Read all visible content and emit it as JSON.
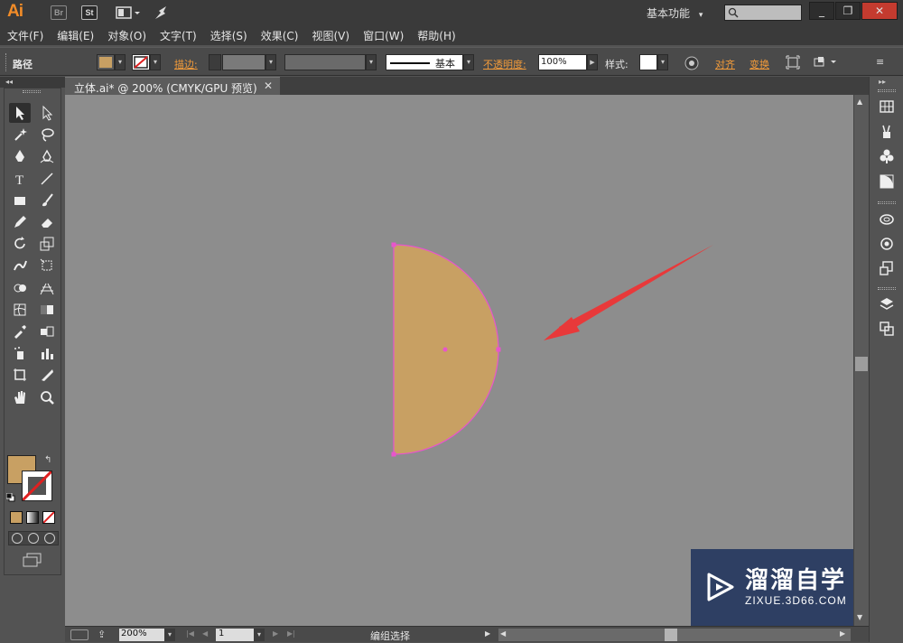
{
  "app": {
    "logo": "Ai",
    "bridge_label": "Br",
    "stock_label": "St",
    "workspace_label": "基本功能",
    "workspace_chevron": "▾",
    "window_buttons": [
      "_",
      "❐",
      "✕"
    ]
  },
  "menu": [
    "文件(F)",
    "编辑(E)",
    "对象(O)",
    "文字(T)",
    "选择(S)",
    "效果(C)",
    "视图(V)",
    "窗口(W)",
    "帮助(H)"
  ],
  "control_bar": {
    "selection_type": "路径",
    "fill_color": "#c8a063",
    "stroke_label": "描边:",
    "brush_label": "基本",
    "opacity_label": "不透明度:",
    "opacity_value": "100%",
    "style_label": "样式:",
    "align_label": "对齐",
    "transform_label": "变换"
  },
  "document": {
    "tab_title": "立体.ai* @ 200% (CMYK/GPU 预览)",
    "tab_close": "✕"
  },
  "canvas": {
    "background": "#8d8d8d",
    "shape_fill": "#c8a063",
    "shape_stroke": "#e855cc",
    "arrow_color": "#e8393a"
  },
  "toolbar": {
    "fill_swatch": "#c8a063",
    "tools": [
      "selection-tool",
      "direct-selection-tool",
      "magic-wand-tool",
      "lasso-tool",
      "pen-tool",
      "curvature-tool",
      "type-tool",
      "line-segment-tool",
      "rectangle-tool",
      "paintbrush-tool",
      "pencil-tool",
      "eraser-tool",
      "rotate-tool",
      "scale-tool",
      "warp-tool",
      "free-transform-tool",
      "shape-builder-tool",
      "perspective-grid-tool",
      "mesh-tool",
      "gradient-tool",
      "eyedropper-tool",
      "blend-tool",
      "symbol-sprayer-tool",
      "column-graph-tool",
      "artboard-tool",
      "slice-tool",
      "hand-tool",
      "zoom-tool"
    ]
  },
  "status_bar": {
    "zoom_value": "200%",
    "page_value": "1",
    "status_text": "编组选择"
  },
  "watermark": {
    "title": "溜溜自学",
    "subtitle": "ZIXUE.3D66.COM"
  }
}
